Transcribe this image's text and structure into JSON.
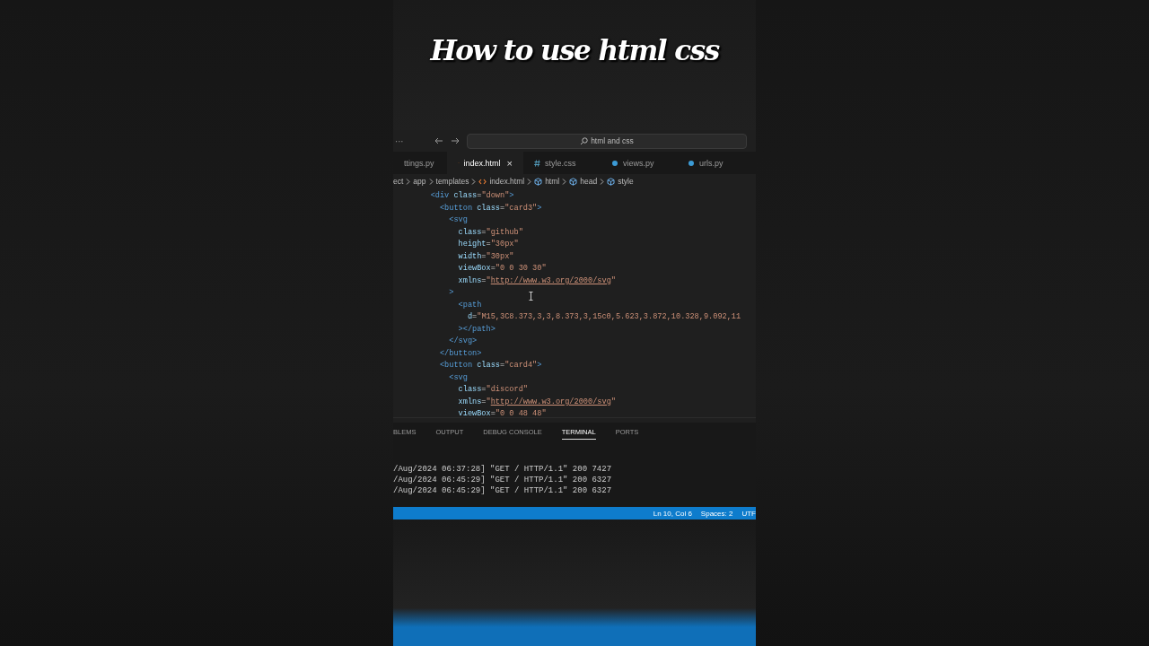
{
  "title": "How to use html css",
  "editor": {
    "title_bar": {
      "menu": "···",
      "search": "html and css"
    },
    "tabs": [
      {
        "label": "ttings.py",
        "selected": false
      },
      {
        "label": "index.html",
        "kind": "html",
        "selected": true,
        "close": "×"
      },
      {
        "label": "style.css",
        "kind": "css",
        "selected": false
      },
      {
        "label": "views.py",
        "kind": "python",
        "selected": false
      },
      {
        "label": "urls.py",
        "kind": "python",
        "selected": false
      }
    ],
    "breadcrumb": [
      {
        "label": "ect",
        "kind": "folder"
      },
      {
        "label": "app",
        "kind": "folder"
      },
      {
        "label": "templates",
        "kind": "folder"
      },
      {
        "label": "index.html",
        "kind": "html"
      },
      {
        "label": "html",
        "kind": "element"
      },
      {
        "label": "head",
        "kind": "element"
      },
      {
        "label": "style",
        "kind": "element"
      }
    ],
    "code_lines": [
      [
        {
          "kind": "tag",
          "text": "    <div "
        },
        {
          "kind": "attr",
          "text": "class"
        },
        {
          "kind": "punct",
          "text": "="
        },
        {
          "kind": "string",
          "text": "\"down\""
        },
        {
          "kind": "tag",
          "text": ">"
        }
      ],
      [
        {
          "kind": "tag",
          "text": "      <button "
        },
        {
          "kind": "attr",
          "text": "class"
        },
        {
          "kind": "punct",
          "text": "="
        },
        {
          "kind": "string",
          "text": "\"card3\""
        },
        {
          "kind": "tag",
          "text": ">"
        }
      ],
      [
        {
          "kind": "tag",
          "text": "        <svg"
        }
      ],
      [
        {
          "kind": "attr",
          "text": "          class"
        },
        {
          "kind": "punct",
          "text": "="
        },
        {
          "kind": "string",
          "text": "\"github\""
        }
      ],
      [
        {
          "kind": "attr",
          "text": "          height"
        },
        {
          "kind": "punct",
          "text": "="
        },
        {
          "kind": "string",
          "text": "\"30px\""
        }
      ],
      [
        {
          "kind": "attr",
          "text": "          width"
        },
        {
          "kind": "punct",
          "text": "="
        },
        {
          "kind": "string",
          "text": "\"30px\""
        }
      ],
      [
        {
          "kind": "attr",
          "text": "          viewBox"
        },
        {
          "kind": "punct",
          "text": "="
        },
        {
          "kind": "string",
          "text": "\"0 0 30 30\""
        }
      ],
      [
        {
          "kind": "attr",
          "text": "          xmlns"
        },
        {
          "kind": "punct",
          "text": "="
        },
        {
          "kind": "string",
          "text": "\""
        },
        {
          "kind": "link",
          "text": "http://www.w3.org/2000/svg"
        },
        {
          "kind": "string",
          "text": "\""
        }
      ],
      [
        {
          "kind": "tag",
          "text": "        >"
        }
      ],
      [
        {
          "kind": "tag",
          "text": "          <path"
        }
      ],
      [
        {
          "kind": "attr",
          "text": "            d"
        },
        {
          "kind": "punct",
          "text": "="
        },
        {
          "kind": "string",
          "text": "\"M15,3C8.373,3,3,8.373,3,15c0,5.623,3.872,10.328,9.092,11"
        }
      ],
      [
        {
          "kind": "tag",
          "text": "          ></path>"
        }
      ],
      [
        {
          "kind": "tag",
          "text": "        </svg>"
        }
      ],
      [
        {
          "kind": "tag",
          "text": "      </button>"
        }
      ],
      [
        {
          "kind": "tag",
          "text": "      <button "
        },
        {
          "kind": "attr",
          "text": "class"
        },
        {
          "kind": "punct",
          "text": "="
        },
        {
          "kind": "string",
          "text": "\"card4\""
        },
        {
          "kind": "tag",
          "text": ">"
        }
      ],
      [
        {
          "kind": "tag",
          "text": "        <svg"
        }
      ],
      [
        {
          "kind": "attr",
          "text": "          class"
        },
        {
          "kind": "punct",
          "text": "="
        },
        {
          "kind": "string",
          "text": "\"discord\""
        }
      ],
      [
        {
          "kind": "attr",
          "text": "          xmlns"
        },
        {
          "kind": "punct",
          "text": "="
        },
        {
          "kind": "string",
          "text": "\""
        },
        {
          "kind": "link",
          "text": "http://www.w3.org/2000/svg"
        },
        {
          "kind": "string",
          "text": "\""
        }
      ],
      [
        {
          "kind": "attr",
          "text": "          viewBox"
        },
        {
          "kind": "punct",
          "text": "="
        },
        {
          "kind": "string",
          "text": "\"0 0 48 48\""
        }
      ]
    ],
    "panel_tabs": [
      {
        "label": "BLEMS",
        "selected": false
      },
      {
        "label": "OUTPUT",
        "selected": false
      },
      {
        "label": "DEBUG CONSOLE",
        "selected": false
      },
      {
        "label": "TERMINAL",
        "selected": true
      },
      {
        "label": "PORTS",
        "selected": false
      }
    ],
    "terminal_lines": [
      "/Aug/2024 06:37:28] \"GET / HTTP/1.1\" 200 7427",
      "/Aug/2024 06:45:29] \"GET / HTTP/1.1\" 200 6327",
      "/Aug/2024 06:45:29] \"GET / HTTP/1.1\" 200 6327"
    ],
    "status_bar": [
      "Ln 10, Col 6",
      "Spaces: 2",
      "UTF"
    ]
  }
}
